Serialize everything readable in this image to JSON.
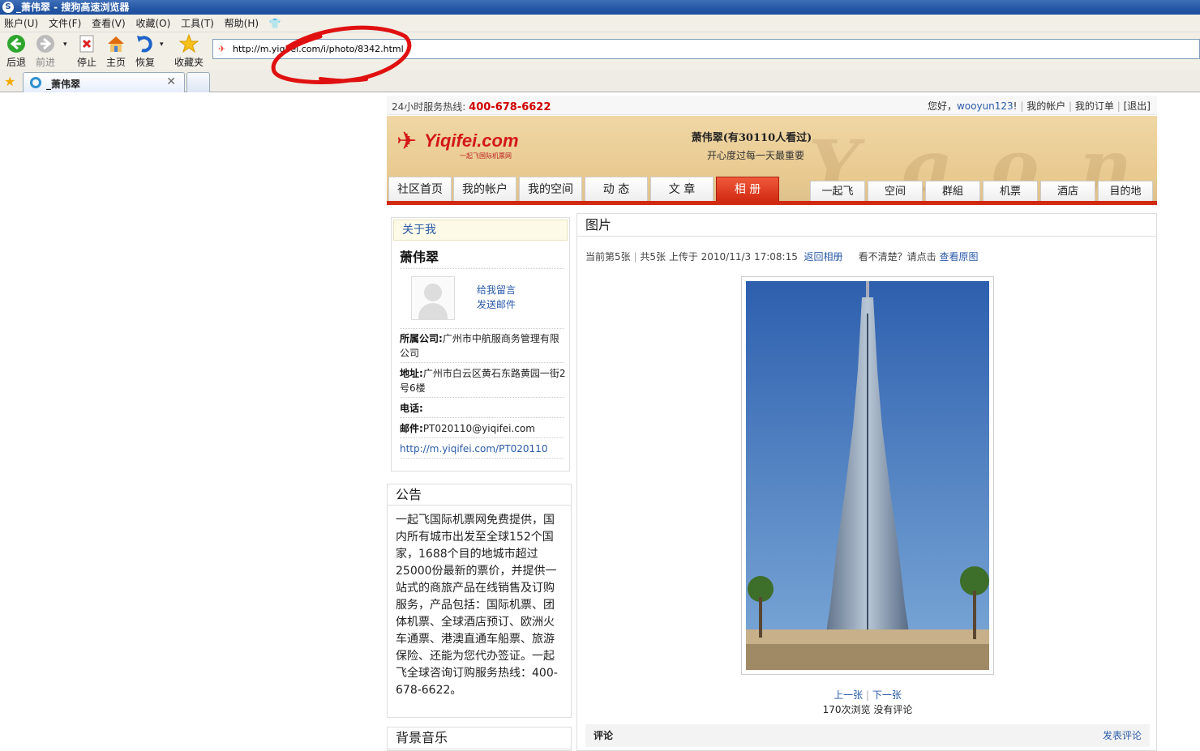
{
  "window": {
    "title": "_萧伟翠 - 搜狗高速浏览器"
  },
  "menu": [
    "账户(U)",
    "文件(F)",
    "查看(V)",
    "收藏(O)",
    "工具(T)",
    "帮助(H)"
  ],
  "toolbar": {
    "back": "后退",
    "forward": "前进",
    "stop": "停止",
    "home": "主页",
    "restore": "恢复",
    "favorites": "收藏夹"
  },
  "address": {
    "url": "http://m.yiqifei.com/i/photo/8342.html"
  },
  "tabs": [
    {
      "label": "_萧伟翠"
    }
  ],
  "site": {
    "hotline_label": "24小时服务热线:",
    "hotline": "400-678-6622",
    "greeting": "您好，",
    "username": "wooyun123",
    "greeting_end": "!",
    "my_account": "我的帐户",
    "my_orders": "我的订单",
    "logout": "[退出]",
    "logo_brand": "Yiqifei.com",
    "logo_sub": "一起飞国际机票网",
    "profile_title": "萧伟翠(有30110人看过)",
    "motto": "开心度过每一天最重要",
    "nav_main": [
      "社区首页",
      "我的帐户",
      "我的空间",
      "动 态",
      "文 章",
      "相 册"
    ],
    "nav_sub": [
      "一起飞",
      "空间",
      "群組",
      "机票",
      "酒店",
      "目的地"
    ]
  },
  "about": {
    "header": "关于我",
    "name": "萧伟翠",
    "leave_message": "给我留言",
    "send_mail": "发送邮件",
    "company_label": "所属公司:",
    "company": "广州市中航服商务管理有限公司",
    "address_label": "地址:",
    "address": "广州市白云区黄石东路黄园一街2号6楼",
    "phone_label": "电话:",
    "email_label": "邮件:",
    "email": "PT020110@yiqifei.com",
    "homepage": "http://m.yiqifei.com/PT020110"
  },
  "notice": {
    "header": "公告",
    "text": "一起飞国际机票网免费提供，国内所有城市出发至全球152个国家，1688个目的地城市超过25000份最新的票价，并提供一站式的商旅产品在线销售及订购服务，产品包括：国际机票、团体机票、全球酒店预订、欧洲火车通票、港澳直通车船票、旅游保险、还能为您代办签证。一起飞全球咨询订购服务热线：400-678-6622。"
  },
  "music": {
    "header": "背景音乐"
  },
  "photo": {
    "header": "图片",
    "current": "当前第5张",
    "total": "共5张",
    "uploaded": "上传于 2010/11/3 17:08:15",
    "back_album": "返回相册",
    "unclear": "看不清楚？请点击",
    "view_original": "查看原图",
    "prev": "上一张",
    "next": "下一张",
    "views": "170次浏览 没有评论",
    "comment_header": "评论",
    "post_comment": "发表评论"
  }
}
